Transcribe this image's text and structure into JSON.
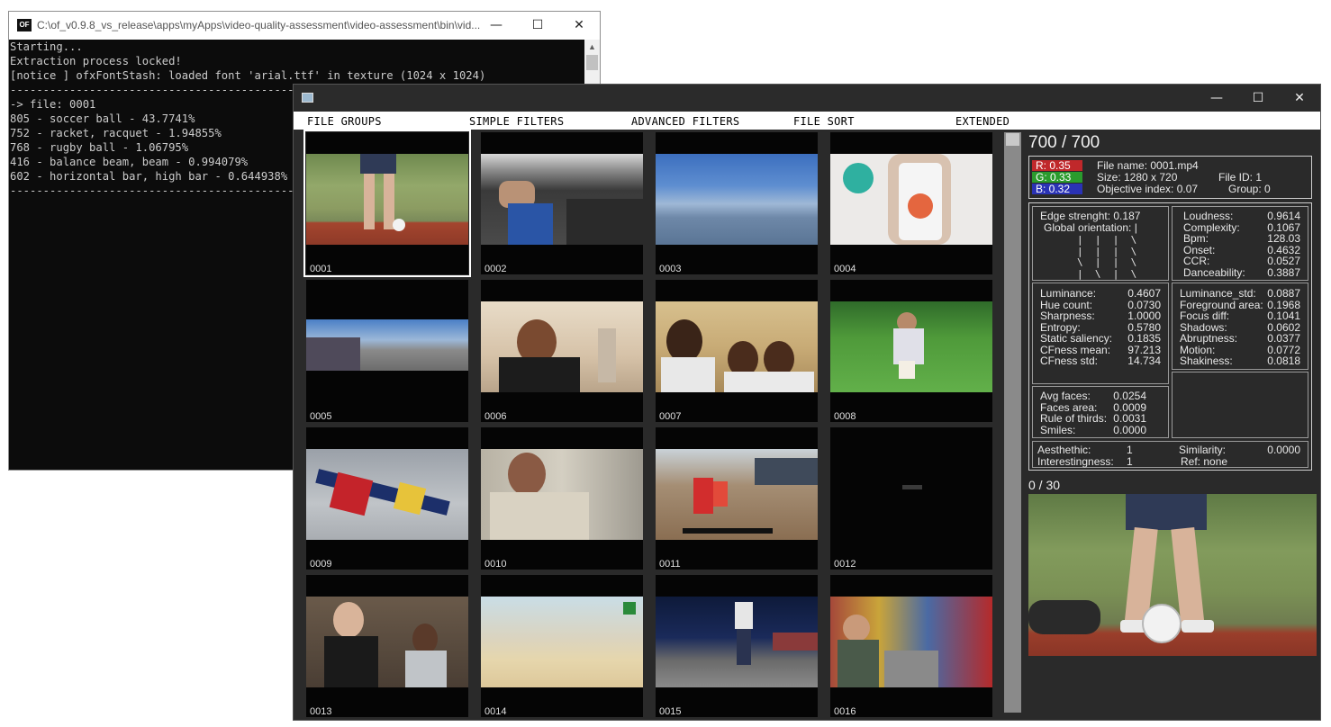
{
  "console": {
    "title": "C:\\of_v0.9.8_vs_release\\apps\\myApps\\video-quality-assessment\\video-assessment\\bin\\vid...",
    "icon": "OF",
    "lines": [
      "Starting...",
      "Extraction process locked!",
      "[notice ] ofxFontStash: loaded font 'arial.ttf' in texture (1024 x 1024)",
      "------------------------------------------------------------------------------------------------",
      "-> file: 0001",
      "805 - soccer ball - 43.7741%",
      "752 - racket, racquet - 1.94855%",
      "768 - rugby ball - 1.06795%",
      "416 - balance beam, beam - 0.994079%",
      "602 - horizontal bar, high bar - 0.644938%",
      "------------------------------------------------------------------------------------------------"
    ]
  },
  "window_controls": {
    "minimize": "—",
    "maximize": "☐",
    "close": "✕"
  },
  "menu": [
    "FILE GROUPS",
    "SIMPLE FILTERS",
    "ADVANCED FILTERS",
    "FILE SORT",
    "EXTENDED"
  ],
  "thumbnails": [
    "0001",
    "0002",
    "0003",
    "0004",
    "0005",
    "0006",
    "0007",
    "0008",
    "0009",
    "0010",
    "0011",
    "0012",
    "0013",
    "0014",
    "0015",
    "0016"
  ],
  "panel": {
    "count": "700 / 700",
    "r_label": "R: 0.35",
    "g_label": "G: 0.33",
    "b_label": "B: 0.32",
    "file_name": "File name: 0001.mp4",
    "size": "Size: 1280 x 720",
    "file_id": "File ID: 1",
    "objective_index": "Objective index: 0.07",
    "group": "Group: 0",
    "edge_strength": "Edge strenght: 0.187",
    "global_orientation": "Global orientation: |",
    "orientation_bars": "|  |  |  \\\n|  |  |  \\\n\\  |  |  \\\n|  \\  |  \\",
    "audio": [
      {
        "label": "Loudness:",
        "value": "0.9614"
      },
      {
        "label": "Complexity:",
        "value": "0.1067"
      },
      {
        "label": "Bpm:",
        "value": "128.03"
      },
      {
        "label": "Onset:",
        "value": "0.4632"
      },
      {
        "label": "CCR:",
        "value": "0.0527"
      },
      {
        "label": "Danceability:",
        "value": "0.3887"
      }
    ],
    "visual_left": [
      {
        "label": "Luminance:",
        "value": "0.4607"
      },
      {
        "label": "Hue count:",
        "value": "0.0730"
      },
      {
        "label": "Sharpness:",
        "value": "1.0000"
      },
      {
        "label": "Entropy:",
        "value": "0.5780"
      },
      {
        "label": "Static saliency:",
        "value": "0.1835"
      },
      {
        "label": "CFness mean:",
        "value": "97.213"
      },
      {
        "label": "CFness std:",
        "value": "14.734"
      }
    ],
    "visual_right": [
      {
        "label": "Luminance_std:",
        "value": "0.0887"
      },
      {
        "label": "Foreground area:",
        "value": "0.1968"
      },
      {
        "label": "Focus diff:",
        "value": "0.1041"
      },
      {
        "label": "Shadows:",
        "value": "0.0602"
      },
      {
        "label": "Abruptness:",
        "value": "0.0377"
      },
      {
        "label": "Motion:",
        "value": "0.0772"
      },
      {
        "label": "Shakiness:",
        "value": "0.0818"
      }
    ],
    "faces": [
      {
        "label": "Avg faces:",
        "value": "0.0254"
      },
      {
        "label": "Faces area:",
        "value": "0.0009"
      },
      {
        "label": "Rule of thirds:",
        "value": "0.0031"
      },
      {
        "label": "Smiles:",
        "value": "0.0000"
      }
    ],
    "aesthetic_label": "Aesthethic:",
    "aesthetic_value": "1",
    "interestingness_label": "Interestingness:",
    "interestingness_value": "1",
    "similarity_label": "Similarity:",
    "similarity_value": "0.0000",
    "ref": "Ref: none",
    "preview_counter": "0 / 30"
  },
  "colors": {
    "r": "#c0282b",
    "g": "#2a9b2d",
    "b": "#2a32b5",
    "main_bg": "#2a2a2a",
    "console_bg": "#0c0c0c"
  }
}
